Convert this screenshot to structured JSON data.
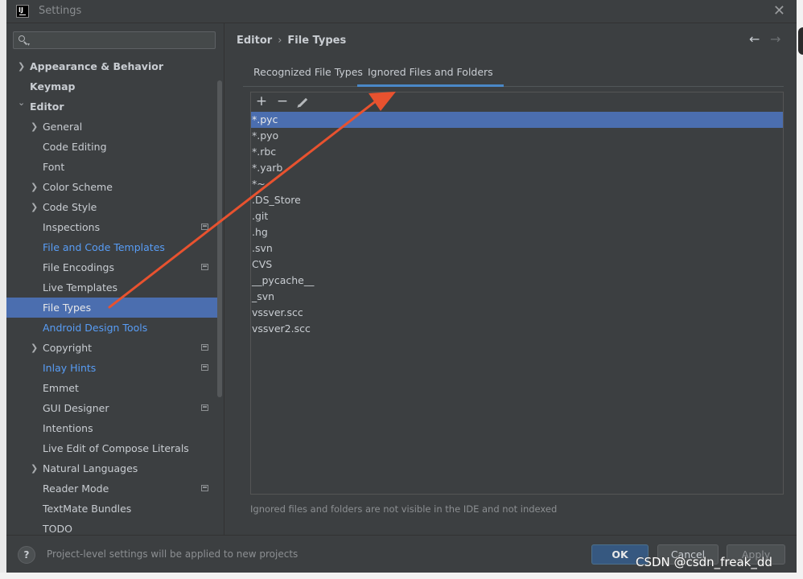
{
  "window": {
    "title": "Settings",
    "close_glyph": "✕"
  },
  "search": {
    "placeholder": "",
    "value": ""
  },
  "sidebar": {
    "items": [
      {
        "label": "Appearance & Behavior",
        "arrow": "❯",
        "level": 0,
        "bold": true,
        "link": false,
        "proj": false,
        "selected": false
      },
      {
        "label": "Keymap",
        "arrow": "",
        "level": 0,
        "bold": true,
        "link": false,
        "proj": false,
        "selected": false
      },
      {
        "label": "Editor",
        "arrow": "⌄",
        "level": 0,
        "bold": true,
        "link": false,
        "proj": false,
        "selected": false
      },
      {
        "label": "General",
        "arrow": "❯",
        "level": 1,
        "bold": false,
        "link": false,
        "proj": false,
        "selected": false
      },
      {
        "label": "Code Editing",
        "arrow": "",
        "level": 1,
        "bold": false,
        "link": false,
        "proj": false,
        "selected": false
      },
      {
        "label": "Font",
        "arrow": "",
        "level": 1,
        "bold": false,
        "link": false,
        "proj": false,
        "selected": false
      },
      {
        "label": "Color Scheme",
        "arrow": "❯",
        "level": 1,
        "bold": false,
        "link": false,
        "proj": false,
        "selected": false
      },
      {
        "label": "Code Style",
        "arrow": "❯",
        "level": 1,
        "bold": false,
        "link": false,
        "proj": false,
        "selected": false
      },
      {
        "label": "Inspections",
        "arrow": "",
        "level": 1,
        "bold": false,
        "link": false,
        "proj": true,
        "selected": false
      },
      {
        "label": "File and Code Templates",
        "arrow": "",
        "level": 1,
        "bold": false,
        "link": true,
        "proj": false,
        "selected": false
      },
      {
        "label": "File Encodings",
        "arrow": "",
        "level": 1,
        "bold": false,
        "link": false,
        "proj": true,
        "selected": false
      },
      {
        "label": "Live Templates",
        "arrow": "",
        "level": 1,
        "bold": false,
        "link": false,
        "proj": false,
        "selected": false
      },
      {
        "label": "File Types",
        "arrow": "",
        "level": 1,
        "bold": false,
        "link": false,
        "proj": false,
        "selected": true
      },
      {
        "label": "Android Design Tools",
        "arrow": "",
        "level": 1,
        "bold": false,
        "link": true,
        "proj": false,
        "selected": false
      },
      {
        "label": "Copyright",
        "arrow": "❯",
        "level": 1,
        "bold": false,
        "link": false,
        "proj": true,
        "selected": false
      },
      {
        "label": "Inlay Hints",
        "arrow": "",
        "level": 1,
        "bold": false,
        "link": true,
        "proj": true,
        "selected": false
      },
      {
        "label": "Emmet",
        "arrow": "",
        "level": 1,
        "bold": false,
        "link": false,
        "proj": false,
        "selected": false
      },
      {
        "label": "GUI Designer",
        "arrow": "",
        "level": 1,
        "bold": false,
        "link": false,
        "proj": true,
        "selected": false
      },
      {
        "label": "Intentions",
        "arrow": "",
        "level": 1,
        "bold": false,
        "link": false,
        "proj": false,
        "selected": false
      },
      {
        "label": "Live Edit of Compose Literals",
        "arrow": "",
        "level": 1,
        "bold": false,
        "link": false,
        "proj": false,
        "selected": false
      },
      {
        "label": "Natural Languages",
        "arrow": "❯",
        "level": 1,
        "bold": false,
        "link": false,
        "proj": false,
        "selected": false
      },
      {
        "label": "Reader Mode",
        "arrow": "",
        "level": 1,
        "bold": false,
        "link": false,
        "proj": true,
        "selected": false
      },
      {
        "label": "TextMate Bundles",
        "arrow": "",
        "level": 1,
        "bold": false,
        "link": false,
        "proj": false,
        "selected": false
      },
      {
        "label": "TODO",
        "arrow": "",
        "level": 1,
        "bold": false,
        "link": false,
        "proj": false,
        "selected": false
      }
    ]
  },
  "breadcrumb": {
    "parent": "Editor",
    "separator": "›",
    "current": "File Types"
  },
  "nav": {
    "back": "←",
    "forward": "→"
  },
  "tabs": [
    {
      "label": "Recognized File Types",
      "active": false
    },
    {
      "label": "Ignored Files and Folders",
      "active": true
    }
  ],
  "toolbar": {
    "add": "+",
    "remove": "−"
  },
  "ignored": {
    "selected_index": 0,
    "items": [
      "*.pyc",
      "*.pyo",
      "*.rbc",
      "*.yarb",
      "*~",
      ".DS_Store",
      ".git",
      ".hg",
      ".svn",
      "CVS",
      "__pycache__",
      "_svn",
      "vssver.scc",
      "vssver2.scc"
    ]
  },
  "hint": "Ignored files and folders are not visible in the IDE and not indexed",
  "footer": {
    "help": "?",
    "text": "Project-level settings will be applied to new projects",
    "ok": "OK",
    "cancel": "Cancel",
    "apply": "Apply"
  },
  "watermark": "CSDN @csdn_freak_dd",
  "colors": {
    "background": "#3c3f41",
    "selection": "#4b6eaf",
    "link": "#589df6",
    "tab_underline": "#4a88c7",
    "annotation_arrow": "#e8522f"
  }
}
